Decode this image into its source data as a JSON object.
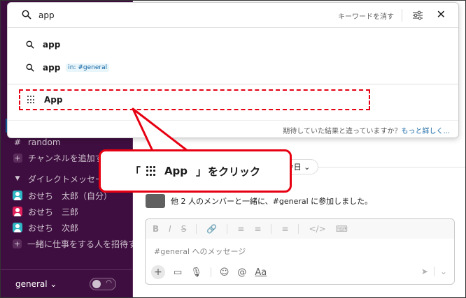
{
  "sidebar": {
    "items": [
      {
        "type": "channel",
        "label": "random"
      },
      {
        "type": "add",
        "label": "チャンネルを追加する"
      },
      {
        "type": "section",
        "label": "ダイレクトメッセージ"
      },
      {
        "type": "dm",
        "label": "おせち　太郎（自分）",
        "avatar": "a1"
      },
      {
        "type": "dm",
        "label": "おせち　三郎",
        "avatar": "a2"
      },
      {
        "type": "dm",
        "label": "おせち　次郎",
        "avatar": "a3"
      },
      {
        "type": "add",
        "label": "一緒に仕事をする人を招待する"
      }
    ],
    "workspace_label": "general ⌄",
    "toggle_icon": "headphones-icon"
  },
  "search": {
    "query": "app",
    "clear_keywords": "キーワードを消す",
    "suggestions": [
      {
        "label": "app",
        "chip": ""
      },
      {
        "label": "app",
        "chip": "in: #general"
      }
    ],
    "app_result": "App",
    "feedback_text": "期待していた結果と違っていますか？",
    "feedback_link": "もっと詳しく..."
  },
  "main": {
    "date_label": "今日 ⌄",
    "message": "他 2 人のメンバーと一緒に、#general に参加しました。",
    "composer_placeholder": "#general へのメッセージ",
    "format_buttons": [
      "B",
      "I",
      "S",
      "🔗",
      "≡",
      "≡",
      "≡",
      "</>",
      "⌨"
    ],
    "action_buttons": [
      "+",
      "▭",
      "🎙",
      "☺",
      "@",
      "Aa"
    ]
  },
  "callout": {
    "open_bracket": "「",
    "app_text": "App",
    "close_bracket": "」",
    "action_text": "をクリック"
  },
  "colors": {
    "sidebar_bg": "#3f0e40",
    "highlight_red": "#e60012",
    "link_blue": "#1264a3"
  }
}
